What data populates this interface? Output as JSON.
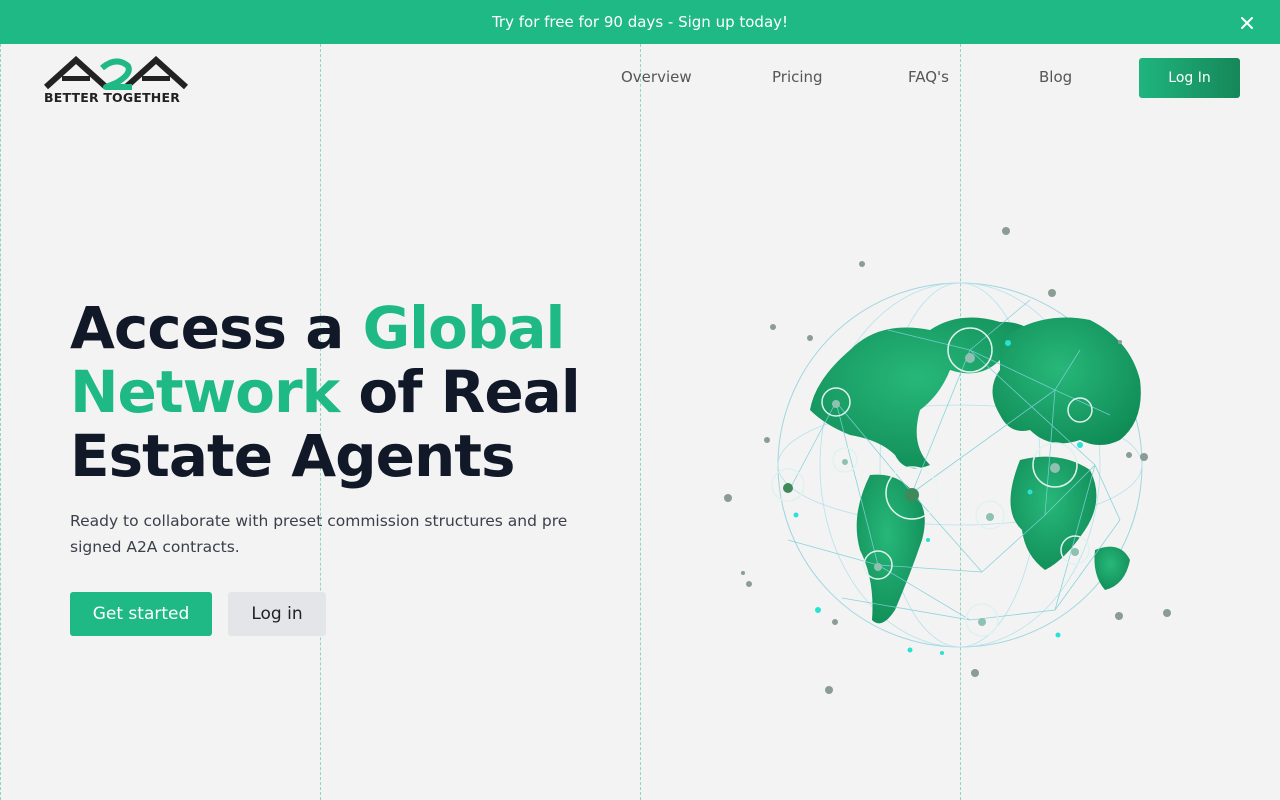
{
  "banner": {
    "text": "Try for free for 90 days - Sign up today!",
    "close_icon": "close-icon"
  },
  "header": {
    "logo": {
      "mark": "A2A",
      "tagline": "BETTER TOGETHER"
    },
    "nav": [
      {
        "label": "Overview"
      },
      {
        "label": "Pricing"
      },
      {
        "label": "FAQ's"
      },
      {
        "label": "Blog"
      }
    ],
    "login_label": "Log In"
  },
  "hero": {
    "title_part1": "Access a ",
    "title_highlight": "Global Network",
    "title_part2": " of Real Estate Agents",
    "subtitle": "Ready to collaborate with preset commission structures and pre signed A2A contracts.",
    "primary_cta": "Get started",
    "secondary_cta": "Log in",
    "illustration": "globe-network-icon"
  },
  "colors": {
    "accent": "#1eb985",
    "accent_dark": "#168759",
    "background": "#f3f3f3",
    "heading": "#111827"
  }
}
